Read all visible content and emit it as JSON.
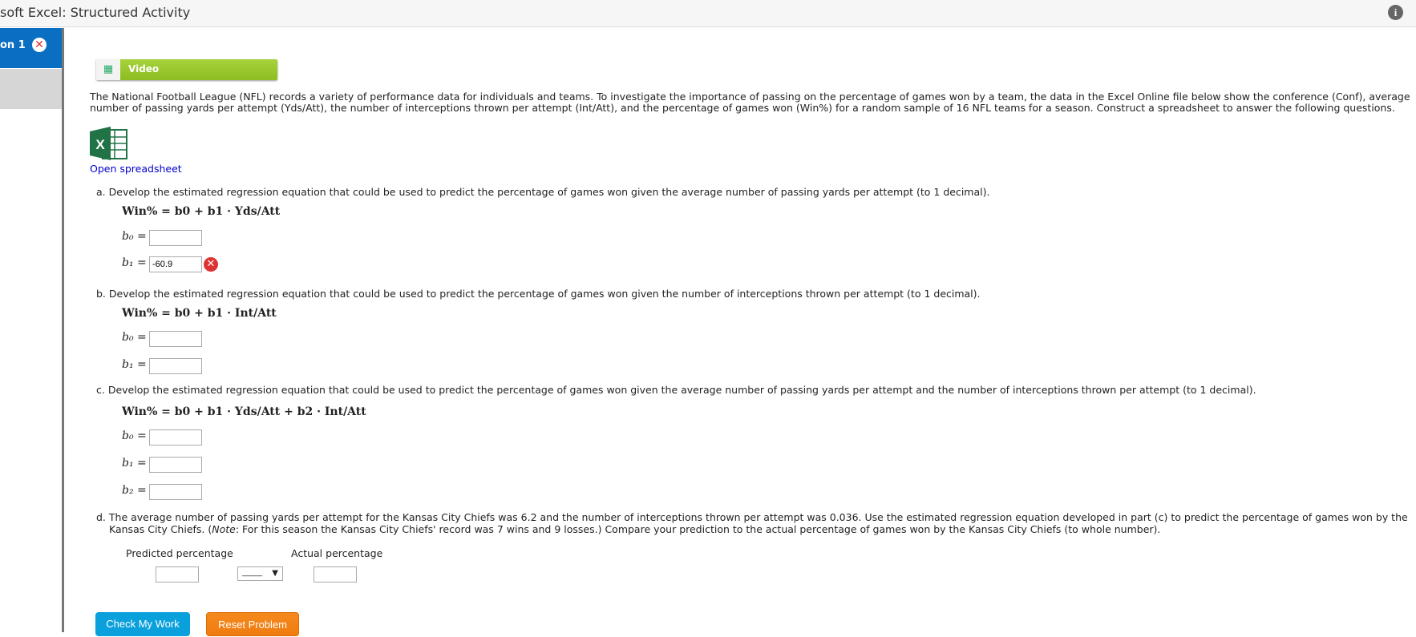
{
  "header": {
    "title": "soft Excel: Structured Activity",
    "info_icon": "info-icon"
  },
  "sidebar": {
    "tab_label": "on 1",
    "tab_status_icon": "error-x-icon"
  },
  "video": {
    "label": "Video"
  },
  "intro": "The National Football League (NFL) records a variety of performance data for individuals and teams. To investigate the importance of passing on the percentage of games won by a team, the data in the Excel Online file below show the conference (Conf), average number of passing yards per attempt (Yds/Att), the number of interceptions thrown per attempt (Int/Att), and the percentage of games won (Win%) for a random sample of 16 NFL teams for a season. Construct a spreadsheet to answer the following questions.",
  "open_spreadsheet": "Open spreadsheet",
  "qa": {
    "letter": "a.",
    "text": "Develop the estimated regression equation that could be used to predict the percentage of games won given the average number of passing yards per attempt (to 1 decimal).",
    "eq": "Win% = b0 + b1 · Yds/Att",
    "b0": "",
    "b1": "-60.9"
  },
  "qb": {
    "letter": "b.",
    "text": "Develop the estimated regression equation that could be used to predict the percentage of games won given the number of interceptions thrown per attempt (to 1 decimal).",
    "eq": "Win% = b0 + b1 · Int/Att",
    "b0": "",
    "b1": ""
  },
  "qc": {
    "letter": "c.",
    "text": "Develop the estimated regression equation that could be used to predict the percentage of games won given the average number of passing yards per attempt and the number of interceptions thrown per attempt (to 1 decimal).",
    "eq": "Win% = b0 + b1 · Yds/Att + b2 · Int/Att",
    "b0": "",
    "b1": "",
    "b2": ""
  },
  "qd": {
    "letter": "d.",
    "text1": "The average number of passing yards per attempt for the Kansas City Chiefs was 6.2 and the number of interceptions thrown per attempt was 0.036. Use the estimated regression equation developed in part (c) to predict the percentage of games won by the Kansas City Chiefs. (",
    "note": "Note",
    "text2": ": For this season the Kansas City Chiefs' record was 7 wins and 9 losses.) Compare your prediction to the actual percentage of games won by the Kansas City Chiefs (to whole number).",
    "predicted_label": "Predicted percentage",
    "actual_label": "Actual percentage",
    "predicted": "",
    "comparison": "_____",
    "actual": ""
  },
  "buttons": {
    "check": "Check My Work",
    "reset": "Reset Problem"
  },
  "colors": {
    "tab": "#0a6fc2",
    "video": "#8dbd22",
    "check": "#0aa0dc",
    "reset": "#f5891e",
    "error": "#d33333"
  }
}
